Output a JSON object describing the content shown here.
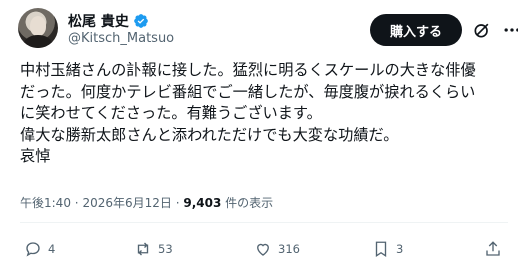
{
  "header": {
    "display_name": "松尾 貴史",
    "handle": "@Kitsch_Matsuo",
    "buy_label": "購入する"
  },
  "tweet": {
    "lines": [
      "中村玉緒さんの訃報に接した。猛烈に明るくスケールの大きな俳優",
      "だった。何度かテレビ番組でご一緒したが、毎度腹が捩れるくらい",
      "に笑わせてくださった。有難うございます。",
      "偉大な勝新太郎さんと添われただけでも大変な功績だ。",
      "哀悼"
    ]
  },
  "meta": {
    "time": "午後1:40",
    "separator": "·",
    "date": "2026年6月12日",
    "views_count": "9,403",
    "views_label": "件の表示"
  },
  "actions": {
    "replies": "4",
    "reposts": "53",
    "likes": "316",
    "bookmarks": "3"
  },
  "colors": {
    "verified": "#1d9bf0",
    "text": "#0f1419",
    "muted": "#536471"
  },
  "icons": [
    "verified-badge-icon",
    "grok-icon",
    "more-icon",
    "reply-icon",
    "repost-icon",
    "like-icon",
    "bookmark-icon",
    "share-icon"
  ]
}
